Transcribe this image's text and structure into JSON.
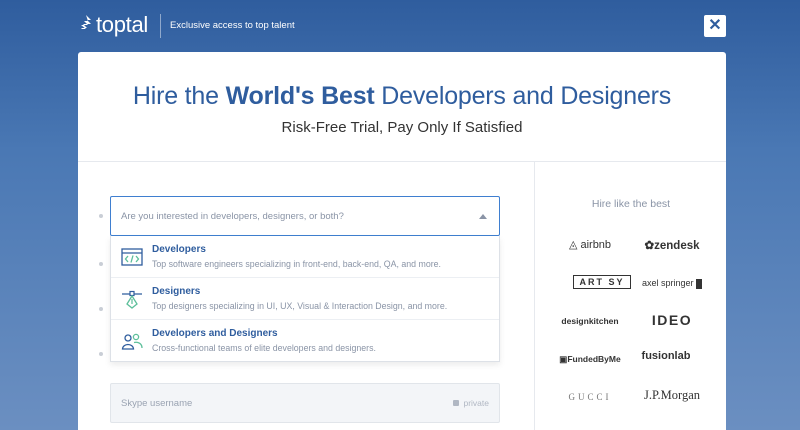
{
  "header": {
    "brand": "toptal",
    "tagline": "Exclusive access to top talent",
    "close_symbol": "✕"
  },
  "hero": {
    "title_pre": "Hire the ",
    "title_bold": "World's Best",
    "title_post": " Developers and Designers",
    "subtitle": "Risk-Free Trial, Pay Only If Satisfied"
  },
  "form": {
    "select_placeholder": "Are you interested in developers, designers, or both?",
    "options": [
      {
        "title": "Developers",
        "desc": "Top software engineers specializing in front-end, back-end, QA, and more.",
        "icon": "code-window-icon"
      },
      {
        "title": "Designers",
        "desc": "Top designers specializing in UI, UX, Visual & Interaction Design, and more.",
        "icon": "pen-tool-icon"
      },
      {
        "title": "Developers and Designers",
        "desc": "Cross-functional teams of elite developers and designers.",
        "icon": "team-icon"
      }
    ],
    "skype_placeholder": "Skype username",
    "skype_private": "private"
  },
  "sidebar": {
    "title": "Hire like the best",
    "logos": [
      "airbnb",
      "zendesk",
      "ART SY",
      "axel springer",
      "designkitchen",
      "IDEO",
      "FundedByMe",
      "fusionlab",
      "GUCCI",
      "J.P.Morgan"
    ]
  },
  "colors": {
    "brand_blue": "#2f5d9e",
    "focus_blue": "#3f7fd0"
  }
}
